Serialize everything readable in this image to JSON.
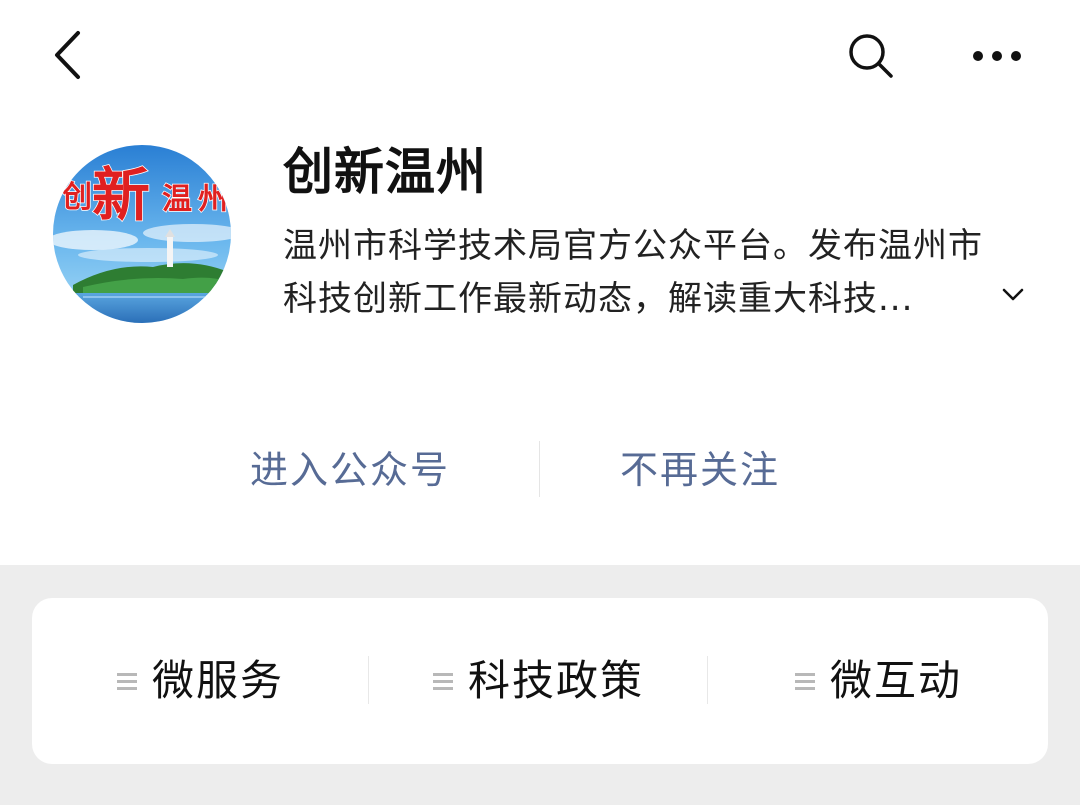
{
  "nav": {
    "back_icon": "chevron-left-icon",
    "search_icon": "search-icon",
    "more_icon": "more-horizontal-icon"
  },
  "account": {
    "avatar_text": [
      "创",
      "新",
      "温",
      "州"
    ],
    "name": "创新温州",
    "description": "温州市科学技术局官方公众平台。发布温州市科技创新工作最新动态，解读重大科技...",
    "expand_icon": "chevron-down-icon"
  },
  "actions": {
    "enter": "进入公众号",
    "unfollow": "不再关注"
  },
  "menu": {
    "items": [
      {
        "label": "微服务",
        "icon": "menu-lines-icon"
      },
      {
        "label": "科技政策",
        "icon": "menu-lines-icon"
      },
      {
        "label": "微互动",
        "icon": "menu-lines-icon"
      }
    ]
  },
  "colors": {
    "background": "#ededed",
    "surface": "#ffffff",
    "link": "#576b95",
    "text": "#111111",
    "avatar_text": "#e02020"
  }
}
